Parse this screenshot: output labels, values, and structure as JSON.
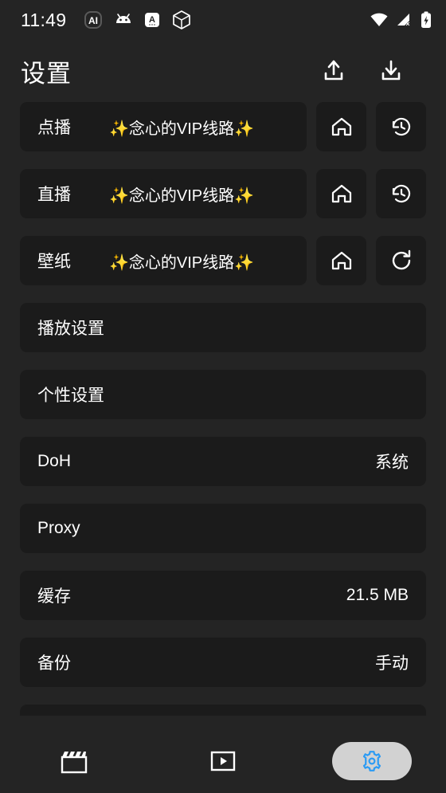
{
  "statusbar": {
    "time": "11:49",
    "left_icons": [
      "ai-assistant-icon",
      "android-robot-icon",
      "translate-app-icon",
      "package-cube-icon"
    ],
    "right_icons": [
      "wifi-icon",
      "cellular-signal-no-sim-icon",
      "battery-charging-icon"
    ]
  },
  "header": {
    "title": "设置",
    "upload_label": "upload-icon",
    "download_label": "download-icon"
  },
  "settings": {
    "rows": [
      {
        "label": "点播",
        "vip_text": "念心的VIP线路",
        "spark": "✨",
        "home_icon": "home-icon",
        "action_icon": "history-icon"
      },
      {
        "label": "直播",
        "vip_text": "念心的VIP线路",
        "spark": "✨",
        "home_icon": "home-icon",
        "action_icon": "history-icon"
      },
      {
        "label": "壁纸",
        "vip_text": "念心的VIP线路",
        "spark": "✨",
        "home_icon": "home-icon",
        "action_icon": "refresh-icon"
      }
    ],
    "items": [
      {
        "label": "播放设置",
        "value": ""
      },
      {
        "label": "个性设置",
        "value": ""
      },
      {
        "label": "DoH",
        "value": "系统"
      },
      {
        "label": "Proxy",
        "value": ""
      },
      {
        "label": "缓存",
        "value": "21.5 MB"
      },
      {
        "label": "备份",
        "value": "手动"
      }
    ]
  },
  "navbar": {
    "items": [
      {
        "icon": "movie-clapperboard-icon",
        "active": false
      },
      {
        "icon": "live-tv-play-icon",
        "active": false
      },
      {
        "icon": "gear-icon",
        "active": true
      }
    ],
    "active_pill_color": "#d2d2d2",
    "active_icon_color": "#2b9bf4"
  },
  "colors": {
    "background": "#242424",
    "card": "#1b1b1b",
    "text": "#ffffff",
    "sparkle": "#f5e050",
    "accent": "#2b9bf4"
  }
}
